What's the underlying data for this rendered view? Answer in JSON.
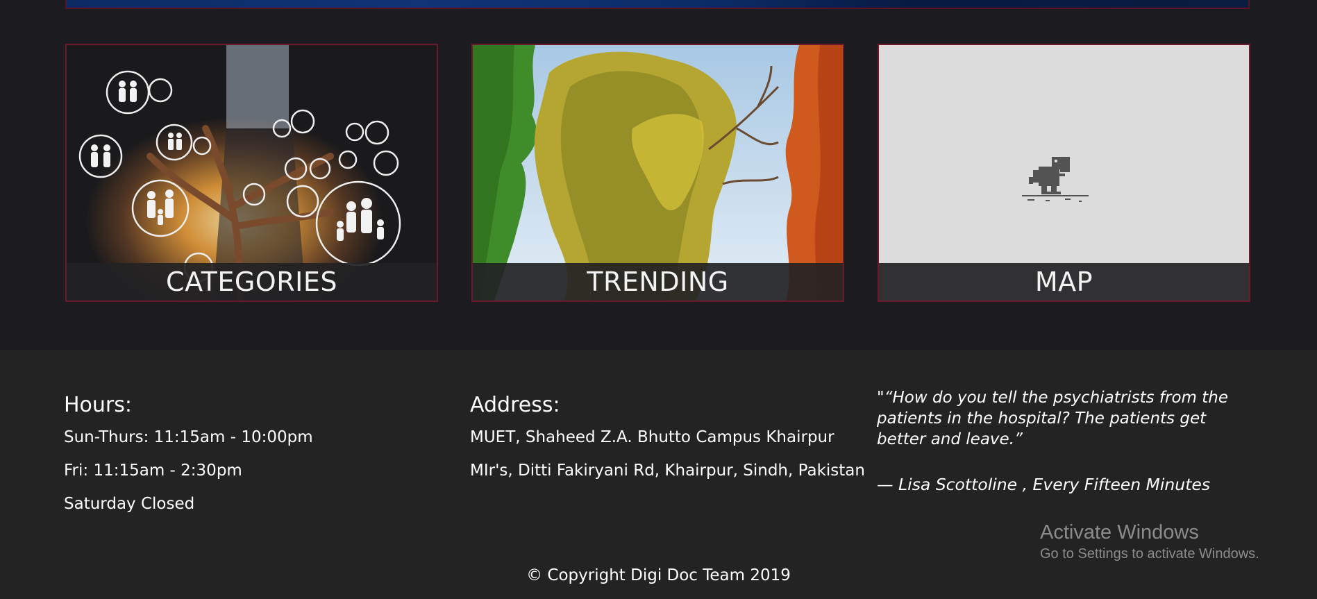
{
  "cards": [
    {
      "label": "CATEGORIES"
    },
    {
      "label": "TRENDING"
    },
    {
      "label": "MAP"
    }
  ],
  "footer": {
    "hours": {
      "title": "Hours:",
      "lines": [
        "Sun-Thurs: 11:15am - 10:00pm",
        "Fri: 11:15am - 2:30pm",
        "Saturday Closed"
      ]
    },
    "address": {
      "title": "Address:",
      "lines": [
        "MUET, Shaheed Z.A. Bhutto Campus Khairpur",
        "MIr's, Ditti Fakiryani Rd, Khairpur, Sindh, Pakistan"
      ]
    },
    "quote": {
      "text": "\"“How do you tell the psychiatrists from the patients in the hospital? The patients get better and leave.”",
      "attribution": "— Lisa Scottoline , Every Fifteen Minutes"
    },
    "copyright": "© Copyright Digi Doc Team 2019"
  },
  "watermark": {
    "title": "Activate Windows",
    "subtitle": "Go to Settings to activate Windows."
  },
  "colors": {
    "page_bg": "#1c1b20",
    "footer_bg": "#232323",
    "card_border": "#6b1a2c"
  }
}
